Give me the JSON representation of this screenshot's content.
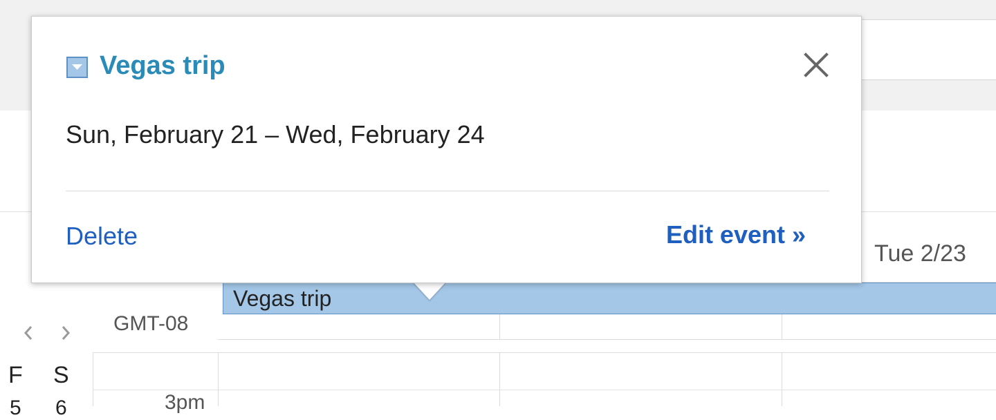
{
  "calendar": {
    "day_header": "Tue 2/23",
    "timezone": "GMT-08",
    "event_bar_title": "Vegas trip",
    "mini_cal_letters": [
      "F",
      "S"
    ],
    "mini_cal_numbers": [
      "5",
      "6"
    ],
    "time_label": "3pm",
    "event_color": "#a4c7e8",
    "event_border_color": "#5f91c6",
    "prev_icon": "chevron-left-icon",
    "next_icon": "chevron-right-icon"
  },
  "popup": {
    "title": "Vegas trip",
    "dates": "Sun, February 21 – Wed, February 24",
    "delete_label": "Delete",
    "edit_label": "Edit event »",
    "close_icon": "close-icon",
    "calendar_chip_icon": "dropdown-arrow-icon",
    "title_color": "#2a8bb8",
    "link_color": "#1f5fbf"
  }
}
